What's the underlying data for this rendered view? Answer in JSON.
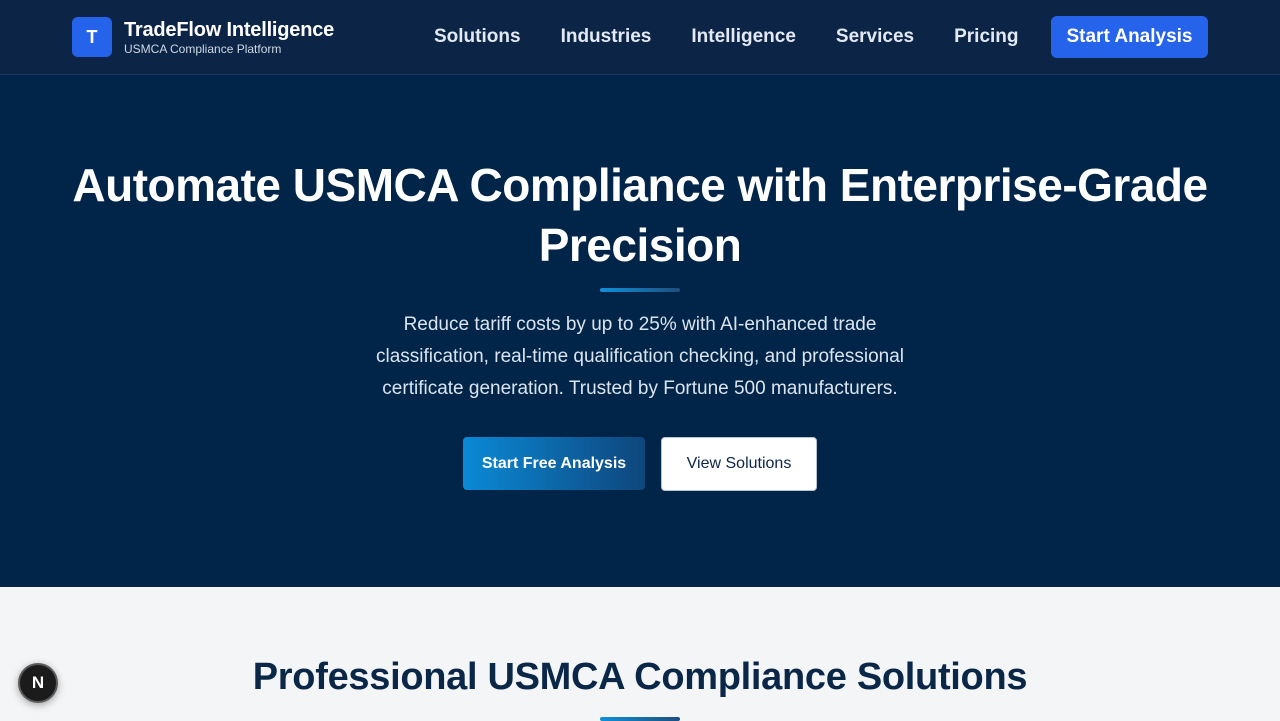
{
  "brand": {
    "logo_letter": "T",
    "name": "TradeFlow Intelligence",
    "tagline": "USMCA Compliance Platform",
    "primary_color": "#2563eb",
    "nav_bg_color": "#0c2546"
  },
  "nav": {
    "links": [
      {
        "label": "Solutions"
      },
      {
        "label": "Industries"
      },
      {
        "label": "Intelligence"
      },
      {
        "label": "Services"
      },
      {
        "label": "Pricing"
      }
    ],
    "cta_label": "Start Analysis"
  },
  "hero": {
    "bg_color": "#012548",
    "title": "Automate USMCA Compliance with Enterprise-Grade Precision",
    "description": "Reduce tariff costs by up to 25% with AI-enhanced trade classification, real-time qualification checking, and professional certificate generation. Trusted by Fortune 500 manufacturers.",
    "primary_button": "Start Free Analysis",
    "secondary_button": "View Solutions"
  },
  "solutions_section": {
    "title": "Professional USMCA Compliance Solutions"
  },
  "dev_badge": {
    "letter": "N",
    "icon": "nextjs-icon"
  }
}
